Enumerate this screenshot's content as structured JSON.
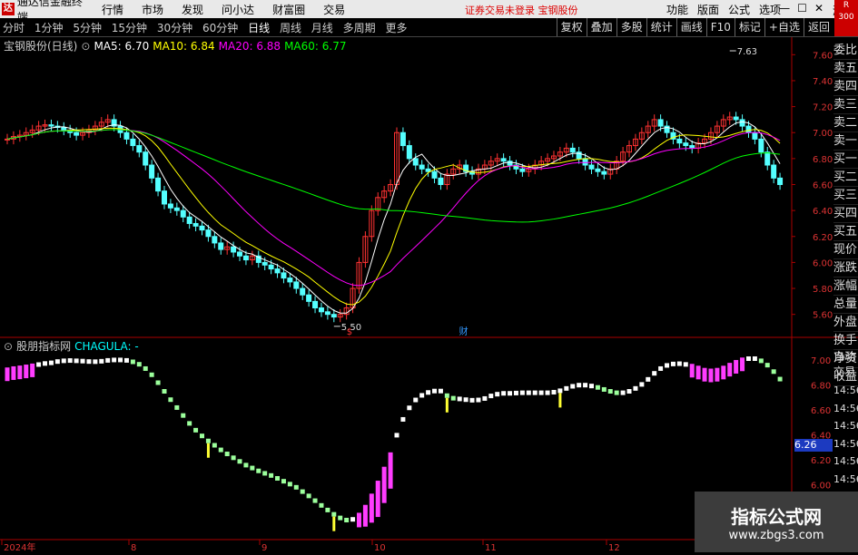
{
  "menubar": {
    "app_title": "通达信金融终端",
    "items": [
      "行情",
      "市场",
      "发现",
      "问小达",
      "财富圈",
      "交易"
    ],
    "notice": "证券交易未登录 宝钢股份",
    "right_items": [
      "功能",
      "版面",
      "公式",
      "选项"
    ],
    "guest": "游客"
  },
  "toolbar": {
    "periods": [
      "分时",
      "1分钟",
      "5分钟",
      "15分钟",
      "30分钟",
      "60分钟",
      "日线",
      "周线",
      "月线",
      "多周期",
      "更多"
    ],
    "active_period": "日线",
    "right_tools": [
      "复权",
      "叠加",
      "多股",
      "统计",
      "画线",
      "F10",
      "标记",
      "+自选",
      "返回"
    ],
    "corner": [
      "R",
      "300"
    ]
  },
  "main_chart": {
    "stock": "宝钢股份(日线)",
    "ma": [
      {
        "label": "MA5: 6.70",
        "color": "#ffffff"
      },
      {
        "label": "MA10: 6.84",
        "color": "#ffff00"
      },
      {
        "label": "MA20: 6.88",
        "color": "#ff00ff"
      },
      {
        "label": "MA60: 6.77",
        "color": "#00ff00"
      }
    ],
    "high_label": "7.63",
    "low_label": "5.50",
    "marks": [
      "$",
      "财"
    ]
  },
  "indicator": {
    "name": "股朋指标网",
    "formula": "CHAGULA: -"
  },
  "price_box": "6.26",
  "side_panel": [
    "委比",
    "卖五",
    "卖四",
    "卖三",
    "卖二",
    "卖一",
    "买一",
    "买二",
    "买三",
    "买四",
    "买五",
    "现价",
    "涨跌",
    "涨幅",
    "总量",
    "外盘",
    "换手",
    "净资",
    "收益"
  ],
  "side_panel2": [
    "自动",
    "交易"
  ],
  "time_col": [
    "14:56",
    "14:56",
    "14:56",
    "14:56",
    "14:56",
    "14:56",
    "14:56",
    "14:56"
  ],
  "watermark": {
    "line1": "指标公式网",
    "line2": "www.zbgs3.com"
  },
  "chart_data": [
    {
      "type": "candlestick",
      "title": "宝钢股份(日线)",
      "ylim": [
        5.5,
        7.7
      ],
      "y_ticks": [
        7.6,
        7.4,
        7.2,
        7.0,
        6.8,
        6.6,
        6.4,
        6.2,
        6.0,
        5.8,
        5.6
      ],
      "x_ticks": [
        "2024年",
        "8",
        "9",
        "10",
        "11",
        "12"
      ],
      "closes": [
        6.95,
        6.97,
        6.98,
        7.0,
        7.02,
        7.05,
        7.06,
        7.05,
        7.04,
        7.02,
        7.0,
        6.98,
        7.0,
        7.02,
        7.05,
        7.08,
        7.1,
        7.05,
        7.0,
        6.95,
        6.9,
        6.85,
        6.75,
        6.65,
        6.55,
        6.45,
        6.42,
        6.4,
        6.35,
        6.3,
        6.28,
        6.25,
        6.2,
        6.15,
        6.1,
        6.12,
        6.08,
        6.05,
        6.02,
        6.05,
        6.0,
        5.98,
        5.95,
        5.92,
        5.88,
        5.85,
        5.8,
        5.75,
        5.7,
        5.65,
        5.62,
        5.6,
        5.58,
        5.6,
        5.65,
        5.8,
        6.0,
        6.2,
        6.4,
        6.5,
        6.55,
        6.6,
        7.0,
        6.9,
        6.8,
        6.75,
        6.72,
        6.7,
        6.65,
        6.6,
        6.68,
        6.72,
        6.75,
        6.7,
        6.68,
        6.72,
        6.75,
        6.78,
        6.8,
        6.78,
        6.75,
        6.72,
        6.7,
        6.72,
        6.75,
        6.78,
        6.8,
        6.82,
        6.85,
        6.88,
        6.85,
        6.8,
        6.75,
        6.72,
        6.7,
        6.68,
        6.72,
        6.78,
        6.85,
        6.9,
        6.95,
        7.0,
        7.05,
        7.1,
        7.05,
        7.0,
        6.95,
        6.92,
        6.9,
        6.88,
        6.92,
        6.95,
        7.0,
        7.05,
        7.1,
        7.12,
        7.1,
        7.05,
        7.0,
        6.95,
        6.85,
        6.75,
        6.65,
        6.6
      ],
      "ma60_color": "#00ff00"
    },
    {
      "type": "indicator_bars",
      "title": "CHAGULA",
      "y_ticks": [
        7.0,
        6.8,
        6.6,
        6.4,
        6.2,
        6.0
      ]
    }
  ]
}
